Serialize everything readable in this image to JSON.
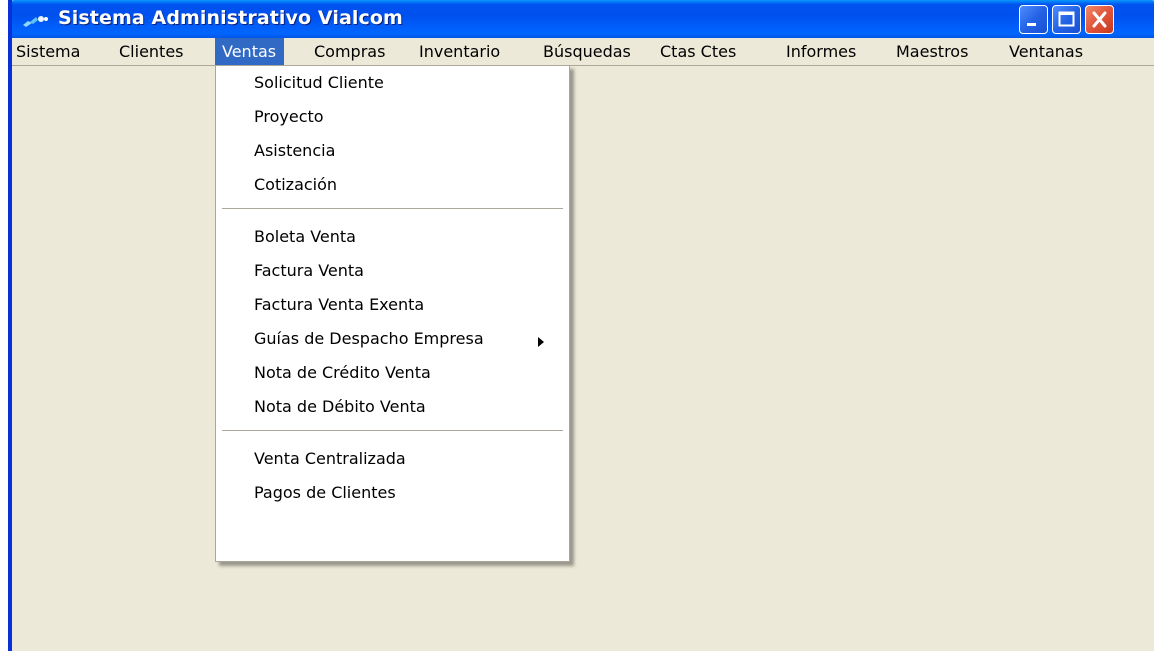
{
  "window": {
    "title": "Sistema Administrativo Vialcom"
  },
  "menubar": {
    "items": [
      {
        "label": "Sistema"
      },
      {
        "label": "Clientes"
      },
      {
        "label": "Ventas"
      },
      {
        "label": "Compras"
      },
      {
        "label": "Inventario"
      },
      {
        "label": "Búsquedas"
      },
      {
        "label": "Ctas Ctes"
      },
      {
        "label": "Informes"
      },
      {
        "label": "Maestros"
      },
      {
        "label": "Ventanas"
      }
    ],
    "active_item": "Ventas"
  },
  "ventas_menu": {
    "group1": [
      {
        "label": "Solicitud Cliente"
      },
      {
        "label": "Proyecto"
      },
      {
        "label": "Asistencia"
      },
      {
        "label": "Cotización"
      }
    ],
    "group2": [
      {
        "label": "Boleta Venta"
      },
      {
        "label": "Factura Venta"
      },
      {
        "label": "Factura Venta Exenta"
      },
      {
        "label": "Guías de Despacho Empresa",
        "submenu": true
      },
      {
        "label": "Nota de Crédito Venta"
      },
      {
        "label": "Nota de Débito Venta"
      }
    ],
    "group3": [
      {
        "label": "Venta Centralizada"
      },
      {
        "label": "Pagos de Clientes"
      }
    ]
  },
  "colors": {
    "titlebar": "#0054e3",
    "menu_highlight": "#316ac5",
    "face": "#ece9d8",
    "close_button": "#e0553b"
  },
  "icons": [
    "app-icon",
    "minimize-icon",
    "maximize-icon",
    "close-icon",
    "submenu-arrow-icon"
  ]
}
